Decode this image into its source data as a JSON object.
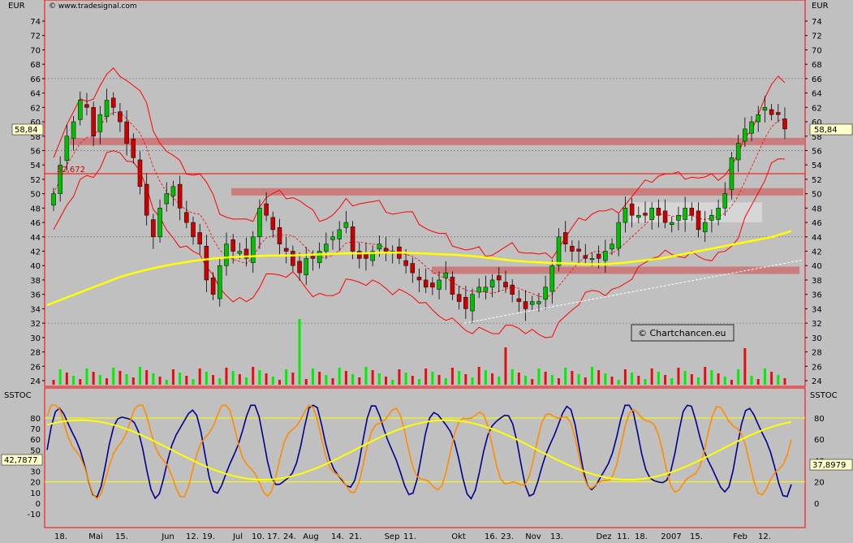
{
  "chart_data": [
    {
      "type": "candlestick",
      "panel": "price",
      "currency_label": "EUR",
      "source_label": "© www.tradesignal.com",
      "watermark": "© Chartchancen.eu",
      "last_price_label": "58,84",
      "last_price": 58.84,
      "level_label": "52,672",
      "level_value": 52.672,
      "ylim": [
        24,
        75
      ],
      "y_ticks": [
        "24",
        "26",
        "28",
        "30",
        "32",
        "34",
        "36",
        "38",
        "40",
        "42",
        "44",
        "46",
        "48",
        "50",
        "52",
        "54",
        "56",
        "58",
        "60",
        "62",
        "64",
        "66",
        "68",
        "70",
        "72",
        "74"
      ],
      "grid": "dotted at 32, 44, 56, 66 plus minor dashed",
      "resistance_zones": [
        {
          "y": 57.2,
          "color": "#cc7070"
        },
        {
          "y": 50.2,
          "color": "#cc7070"
        },
        {
          "y": 39.3,
          "color": "#cc7070"
        }
      ],
      "consolidation_box": {
        "y_low": 46.0,
        "y_high": 48.8,
        "color": "#e8e8e8"
      },
      "close_series": [
        50,
        54,
        58,
        60,
        63,
        62,
        58,
        61,
        63,
        62,
        60,
        57,
        55,
        51,
        47,
        44,
        48,
        50,
        51,
        48,
        46,
        44,
        43,
        38,
        36,
        40,
        43,
        42,
        42,
        41,
        44,
        48,
        47,
        45,
        43,
        42,
        40,
        39,
        41,
        41,
        42,
        43,
        44,
        45,
        46,
        42,
        41,
        41,
        42,
        43,
        42,
        42,
        41,
        40,
        39,
        38,
        37,
        37,
        38,
        39,
        36,
        35,
        34,
        36,
        37,
        37,
        38,
        38,
        37,
        36,
        35,
        34,
        35,
        35,
        37,
        40,
        44,
        43,
        42,
        42,
        41,
        41,
        41,
        42,
        43,
        46,
        48,
        47,
        47,
        47,
        48,
        47,
        46,
        46,
        47,
        48,
        47,
        45,
        46,
        47,
        48,
        50,
        55,
        57,
        59,
        60,
        61,
        62,
        61,
        61,
        59
      ],
      "ma_200": [
        34.5,
        35.5,
        36.5,
        37.5,
        38.5,
        39.2,
        39.8,
        40.3,
        40.7,
        41.0,
        41.2,
        41.3,
        41.4,
        41.4,
        41.5,
        41.6,
        41.7,
        41.7,
        41.8,
        41.8,
        41.7,
        41.6,
        41.5,
        41.3,
        41.0,
        40.7,
        40.5,
        40.4,
        40.3,
        40.2,
        40.2,
        40.4,
        40.7,
        41.0,
        41.5,
        42.0,
        42.5,
        43.0,
        43.5,
        44.0,
        44.8
      ],
      "trendline": {
        "from_value": 32.0,
        "to_value": 40.8
      },
      "volume_bars": "green and red bars at base of price panel, scaled below 34"
    },
    {
      "type": "line",
      "panel": "oscillator",
      "title": "SSTOC",
      "last_value_left_label": "42,7877",
      "last_value_right_label": "37,8979",
      "ylim": [
        -20,
        100
      ],
      "y_ticks_left": [
        "-10",
        "0",
        "10",
        "20",
        "30",
        "40",
        "50",
        "60",
        "70",
        "80"
      ],
      "y_ticks_right": [
        "0",
        "20",
        "40",
        "60",
        "80"
      ],
      "bands": [
        20,
        80
      ],
      "series": [
        {
          "color": "#00008b"
        },
        {
          "color": "#ff8c00"
        },
        {
          "color": "#ffff00"
        }
      ]
    }
  ],
  "x_axis": {
    "tick_labels": [
      "18.",
      "Mai",
      "15.",
      "Jun",
      "12.",
      "19.",
      "Jul",
      "10.",
      "17.",
      "24.",
      "Aug",
      "14.",
      "21.",
      "Sep",
      "11.",
      "Okt",
      "16.",
      "23.",
      "Nov",
      "13.",
      "Dez",
      "11.",
      "18.",
      "2007",
      "15.",
      "Feb",
      "12."
    ]
  },
  "colors": {
    "background": "#c0c0c0",
    "frame": "#ff0000",
    "ma": "#ffff00",
    "bollinger": "#ff0000",
    "candle_up": "#00c000",
    "candle_down": "#cc0000"
  }
}
